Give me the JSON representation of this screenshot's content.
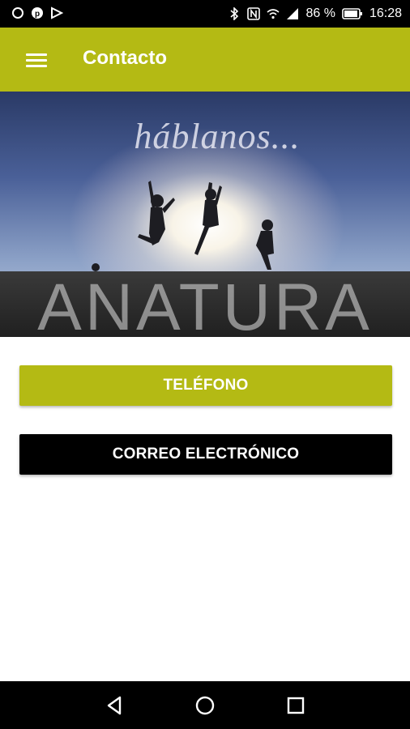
{
  "status_bar": {
    "battery_percent": "86 %",
    "time": "16:28",
    "icons": [
      "sync-icon",
      "pinterest-icon",
      "play-store-icon",
      "bluetooth-icon",
      "nfc-icon",
      "wifi-icon",
      "signal-icon",
      "battery-icon"
    ]
  },
  "app_bar": {
    "title": "Contacto",
    "menu_icon": "hamburger-menu-icon",
    "color": "#b4ba14"
  },
  "hero": {
    "tagline": "háblanos...",
    "brand": "ANATURA"
  },
  "buttons": {
    "phone_label": "TELÉFONO",
    "email_label": "CORREO ELECTRÓNICO",
    "phone_color": "#b4ba14",
    "email_color": "#000000"
  },
  "nav_bar": {
    "icons": [
      "back-icon",
      "home-icon",
      "recents-icon"
    ]
  }
}
